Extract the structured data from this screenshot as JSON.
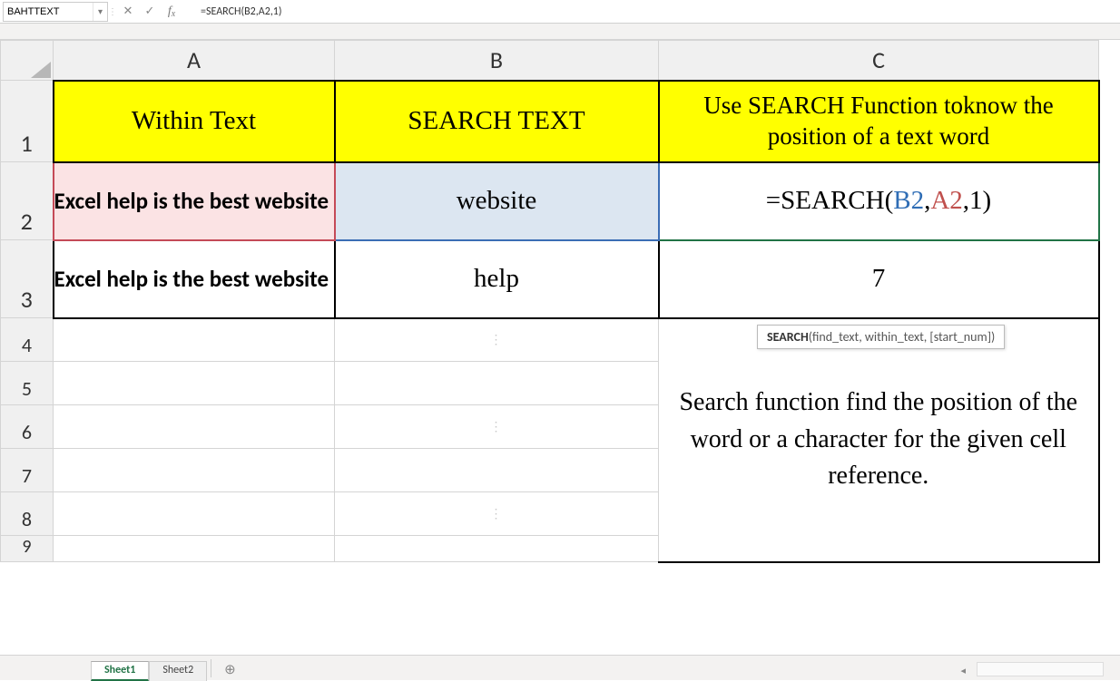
{
  "name_box": "BAHTTEXT",
  "formula_bar_value": "=SEARCH(B2,A2,1)",
  "columns": {
    "A": "A",
    "B": "B",
    "C": "C"
  },
  "rows": {
    "1": "1",
    "2": "2",
    "3": "3",
    "4": "4",
    "5": "5",
    "6": "6",
    "7": "7",
    "8": "8",
    "9": "9"
  },
  "headers": {
    "A": "Within Text",
    "B": "SEARCH TEXT",
    "C": "Use SEARCH Function toknow the position of a text word"
  },
  "cells": {
    "A2": "Excel help is the best website",
    "B2": "website",
    "C2_prefix": "=SEARCH(",
    "C2_b2": "B2",
    "C2_c1": ",",
    "C2_a2": "A2",
    "C2_c2": ",",
    "C2_one": "1",
    "C2_suffix": ")",
    "A3": "Excel help is the best website",
    "B3": "help",
    "C3": "7",
    "C_desc": "Search function find the position of the word or a character for the given cell reference."
  },
  "tooltip": {
    "bold": "SEARCH",
    "rest": "(find_text, within_text, [start_num])"
  },
  "tabs": {
    "sheet1": "Sheet1",
    "sheet2": "Sheet2"
  },
  "chart_data": {
    "type": "table",
    "columns": [
      "Within Text",
      "SEARCH TEXT",
      "Use SEARCH Function toknow the position of a text word"
    ],
    "rows": [
      [
        "Excel help is the best website",
        "website",
        "=SEARCH(B2,A2,1)"
      ],
      [
        "Excel help is the best website",
        "help",
        7
      ]
    ],
    "note": "Search function find the position of the word or a character for the given cell reference."
  }
}
